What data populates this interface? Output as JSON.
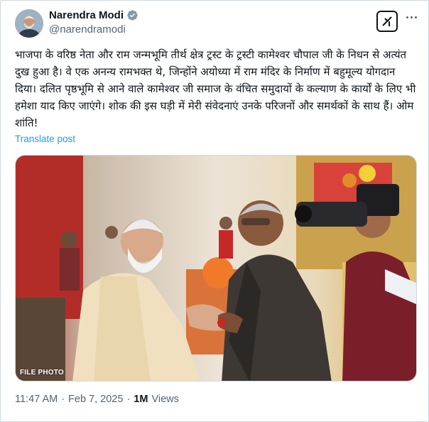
{
  "author": {
    "name": "Narendra Modi",
    "handle": "@narendramodi",
    "verified": true
  },
  "header_actions": {
    "grok_icon": "grok-logo-icon",
    "more_icon": "more-horizontal-icon"
  },
  "tweet": {
    "text": "भाजपा के वरिष्ठ नेता और राम जन्मभूमि तीर्थ क्षेत्र ट्रस्ट के ट्रस्टी कामेश्वर चौपाल जी के निधन से अत्यंत दुख हुआ है। वे एक अनन्य रामभक्त थे, जिन्होंने अयोध्या में राम मंदिर के निर्माण में बहुमूल्य योगदान दिया। दलित पृष्ठभूमि से आने वाले कामेश्वर जी समाज के वंचित समुदायों के कल्याण के कार्यों के लिए भी हमेशा याद किए जाएंगे। शोक की इस घड़ी में मेरी संवेदनाएं उनके परिजनों और समर्थकों के साथ हैं। ओम शांति!",
    "translate_label": "Translate post",
    "media_caption": "FILE PHOTO"
  },
  "meta": {
    "time": "11:47 AM",
    "separator": "·",
    "date": "Feb 7, 2025",
    "views_count": "1M",
    "views_label": "Views"
  },
  "colors": {
    "link": "#1d9bf0",
    "verified": "#829aab",
    "secondary_text": "#536471"
  }
}
